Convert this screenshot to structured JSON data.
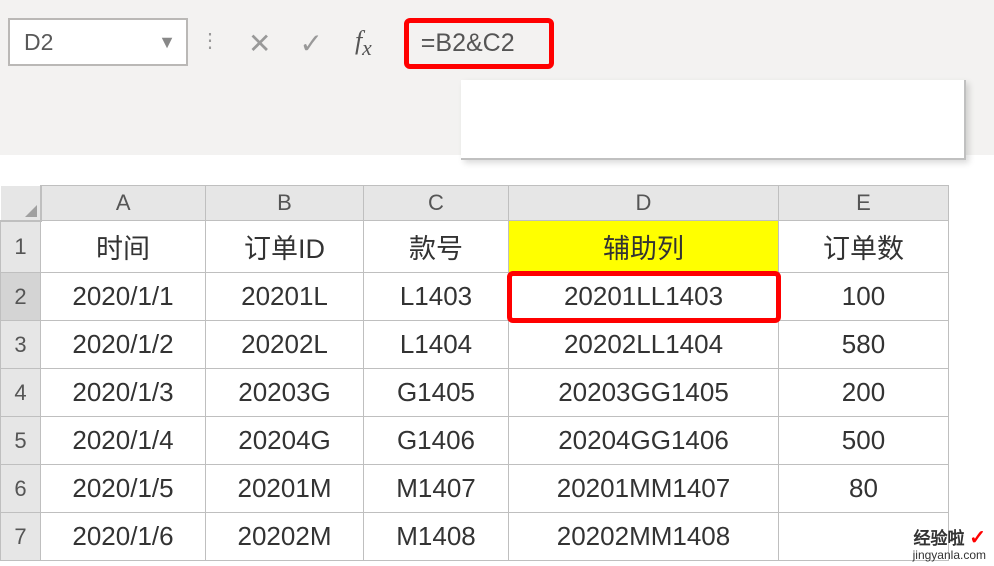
{
  "name_box": {
    "value": "D2"
  },
  "formula_bar": {
    "formula": "=B2&C2"
  },
  "columns": [
    "A",
    "B",
    "C",
    "D",
    "E"
  ],
  "headers": {
    "A": "时间",
    "B": "订单ID",
    "C": "款号",
    "D": "辅助列",
    "E": "订单数"
  },
  "rows": [
    {
      "n": "1"
    },
    {
      "n": "2",
      "A": "2020/1/1",
      "B": "20201L",
      "C": "L1403",
      "D": "20201LL1403",
      "E": "100"
    },
    {
      "n": "3",
      "A": "2020/1/2",
      "B": "20202L",
      "C": "L1404",
      "D": "20202LL1404",
      "E": "580"
    },
    {
      "n": "4",
      "A": "2020/1/3",
      "B": "20203G",
      "C": "G1405",
      "D": "20203GG1405",
      "E": "200"
    },
    {
      "n": "5",
      "A": "2020/1/4",
      "B": "20204G",
      "C": "G1406",
      "D": "20204GG1406",
      "E": "500"
    },
    {
      "n": "6",
      "A": "2020/1/5",
      "B": "20201M",
      "C": "M1407",
      "D": "20201MM1407",
      "E": "80"
    },
    {
      "n": "7",
      "A": "2020/1/6",
      "B": "20202M",
      "C": "M1408",
      "D": "20202MM1408",
      "E": ""
    }
  ],
  "watermark": {
    "line1": "经验啦",
    "check": "✓",
    "line2": "jingyanla.com"
  }
}
